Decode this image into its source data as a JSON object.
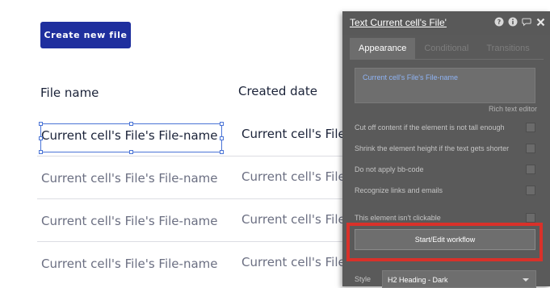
{
  "canvas": {
    "create_button_label": "Create new file",
    "headers": {
      "file_name": "File name",
      "created_date": "Created date"
    },
    "rows": [
      {
        "file_name": "Current cell's File's File-name",
        "created": "Current cell's File"
      },
      {
        "file_name": "Current cell's File's File-name",
        "created": "Current cell's File"
      },
      {
        "file_name": "Current cell's File's File-name",
        "created": "Current cell's File"
      },
      {
        "file_name": "Current cell's File's File-name",
        "created": "Current cell's File"
      }
    ]
  },
  "panel": {
    "title": "Text Current cell's File'",
    "tabs": [
      "Appearance",
      "Conditional",
      "Transitions"
    ],
    "active_tab": "Appearance",
    "rich_text_value": "Current cell's File's File-name",
    "rich_text_editor_link": "Rich text editor",
    "options": [
      "Cut off content if the element is not tall enough",
      "Shrink the element height if the text gets shorter",
      "Do not apply bb-code",
      "Recognize links and emails",
      "This element isn't clickable"
    ],
    "workflow_button": "Start/Edit workflow",
    "style_label": "Style",
    "style_value": "H2 Heading - Dark"
  },
  "colors": {
    "brand_button": "#1f2f9e",
    "highlight": "#d9312a",
    "selection": "#4a74d6"
  },
  "icons": [
    "help-icon",
    "info-icon",
    "comment-icon",
    "close-icon"
  ]
}
